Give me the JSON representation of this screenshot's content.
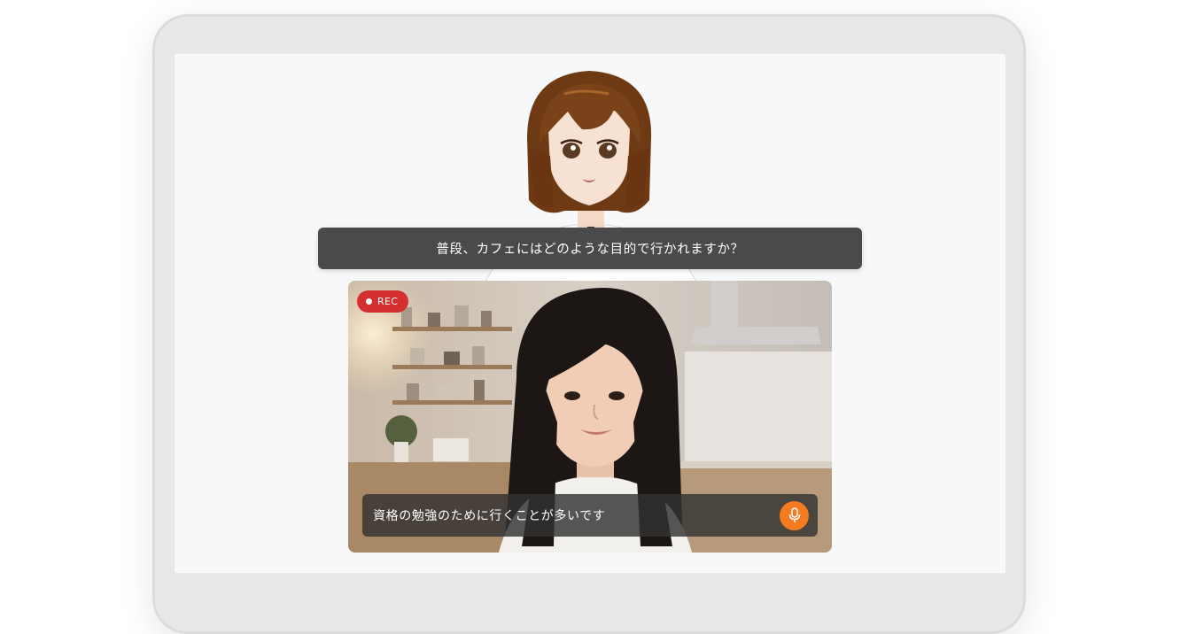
{
  "interview": {
    "question": "普段、カフェにはどのような目的で行かれますか？",
    "answer": "資格の勉強のために行くことが多いです",
    "rec_label": "REC"
  },
  "icons": {
    "mic": "microphone-icon",
    "rec": "recording-dot-icon"
  },
  "colors": {
    "rec_badge": "#d32f2f",
    "mic_button": "#f47b20",
    "question_bar": "#4a4a4a",
    "screen_bg": "#f7f8fa"
  }
}
